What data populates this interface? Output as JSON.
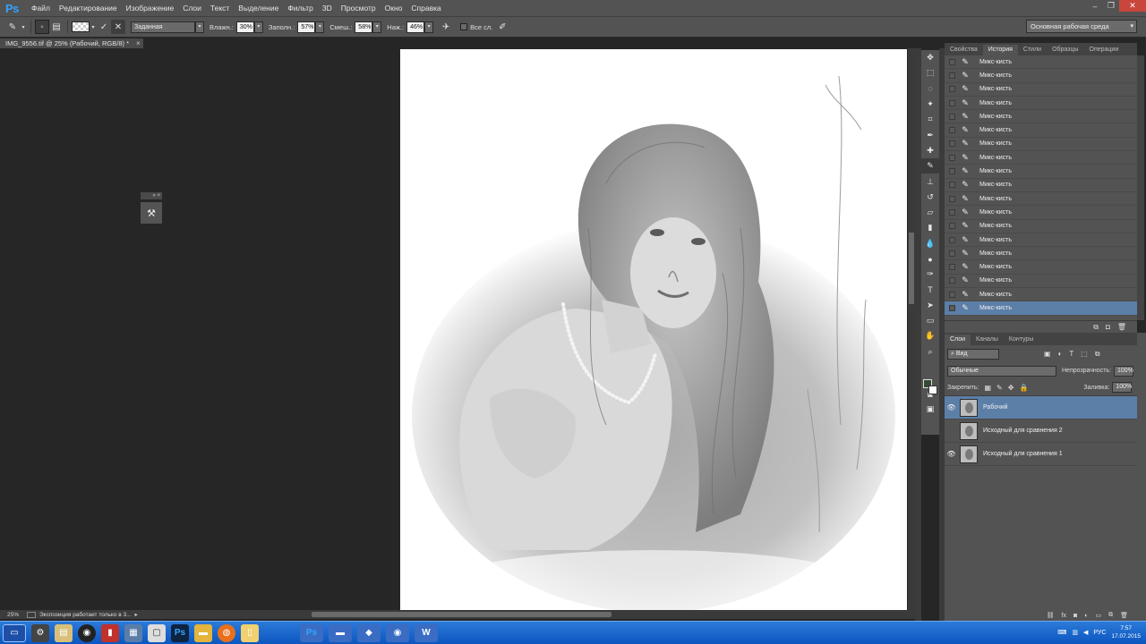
{
  "app": {
    "logo": "Ps"
  },
  "menu": [
    "Файл",
    "Редактирование",
    "Изображение",
    "Слои",
    "Текст",
    "Выделение",
    "Фильтр",
    "3D",
    "Просмотр",
    "Окно",
    "Справка"
  ],
  "options": {
    "preset_label": "Заданная",
    "wet_label": "Влажн.:",
    "wet_value": "30%",
    "load_label": "Заполн.:",
    "load_value": "57%",
    "mix_label": "Смеш.:",
    "mix_value": "58%",
    "flow_label": "Наж.:",
    "flow_value": "46%",
    "all_layers_label": "Все сл."
  },
  "workspace": "Основная рабочая среда",
  "document": {
    "tab_title": "IMG_9556.tif @ 25% (Рабочий, RGB/8) *"
  },
  "status": {
    "zoom": "25%",
    "message": "Экспозиция работает только в 3..."
  },
  "history_panel": {
    "tabs": [
      "Свойства",
      "История",
      "Стили",
      "Образцы",
      "Операции"
    ],
    "active_tab": "История",
    "items": [
      "Микс-кисть",
      "Микс-кисть",
      "Микс-кисть",
      "Микс-кисть",
      "Микс-кисть",
      "Микс-кисть",
      "Микс-кисть",
      "Микс-кисть",
      "Микс-кисть",
      "Микс-кисть",
      "Микс-кисть",
      "Микс-кисть",
      "Микс-кисть",
      "Микс-кисть",
      "Микс-кисть",
      "Микс-кисть",
      "Микс-кисть",
      "Микс-кисть",
      "Микс-кисть"
    ],
    "selected_index": 18
  },
  "layers_panel": {
    "tabs": [
      "Слои",
      "Каналы",
      "Контуры"
    ],
    "active_tab": "Слои",
    "filter_label": "Вид",
    "blend_mode": "Обычные",
    "opacity_label": "Непрозрачность:",
    "opacity_value": "100%",
    "lock_label": "Закрепить:",
    "fill_label": "Заливка:",
    "fill_value": "100%",
    "layers": [
      {
        "name": "Рабочий",
        "visible": true,
        "selected": true
      },
      {
        "name": "Исходный для сравнения 2",
        "visible": false,
        "selected": false
      },
      {
        "name": "Исходный для сравнения 1",
        "visible": true,
        "selected": false
      }
    ]
  },
  "taskbar": {
    "language": "РУС",
    "time": "7:57",
    "date": "17.07.2015"
  },
  "colors": {
    "accent_selection": "#5c7fa8",
    "panel_bg": "#535353",
    "canvas_bg": "#262626",
    "taskbar": "#1a64cc"
  }
}
